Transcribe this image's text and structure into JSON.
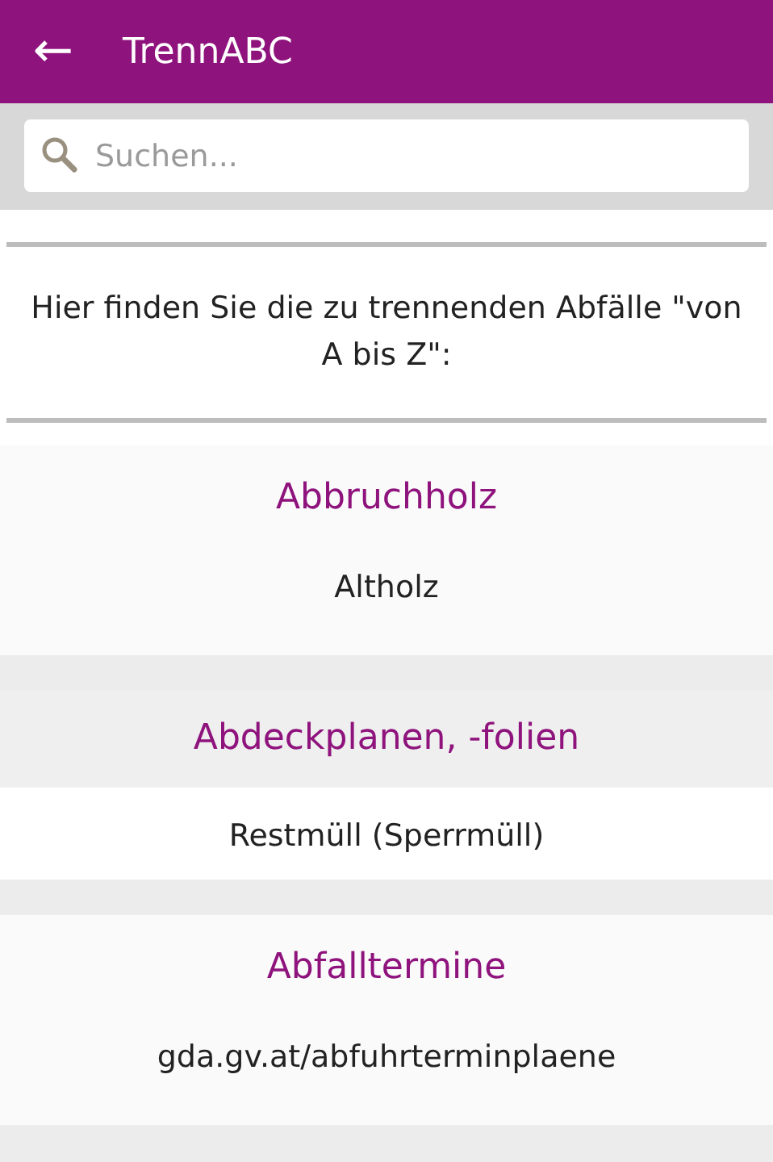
{
  "app_bar": {
    "back_icon": "←",
    "title": "TrennABC"
  },
  "search": {
    "placeholder": "Suchen..."
  },
  "intro": "Hier finden Sie die zu trennenden Abfälle \"von A bis Z\":",
  "entries": [
    {
      "title": "Abbruchholz",
      "detail": "Altholz",
      "selected": false
    },
    {
      "title": "Abdeckplanen, -folien",
      "detail": "Restmüll (Sperrmüll)",
      "selected": true
    },
    {
      "title": "Abfalltermine",
      "detail": "gda.gv.at/abfuhrterminplaene",
      "selected": false
    }
  ]
}
